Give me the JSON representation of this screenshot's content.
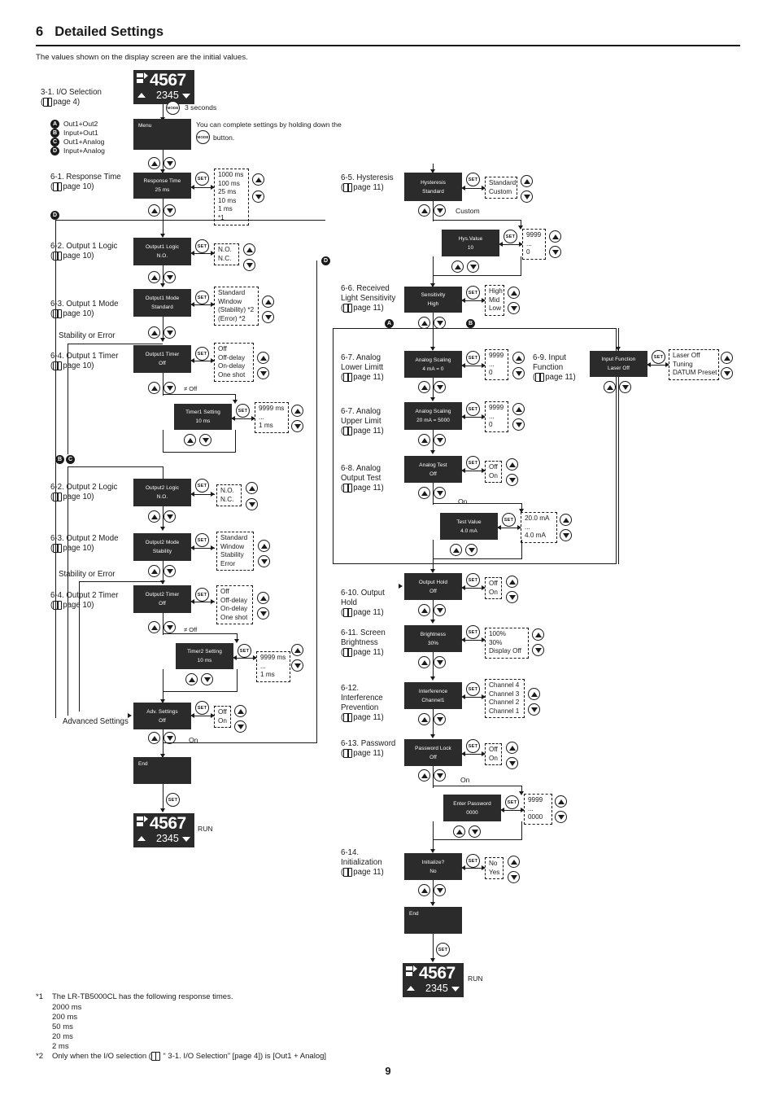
{
  "header": {
    "number": "6",
    "title": "Detailed Settings",
    "intro": "The values shown on the display screen are the initial values."
  },
  "run_display_top": {
    "main": "4567",
    "sub": "2345",
    "label": ""
  },
  "run_display_mid": {
    "main": "4567",
    "sub": "2345",
    "label": "RUN"
  },
  "run_display_bottom": {
    "main": "4567",
    "sub": "2345",
    "label": "RUN"
  },
  "mode_note": {
    "seconds": "3 seconds",
    "button_label": "MODE",
    "text_line1": "You can complete settings by holding down the",
    "text_line2": "button."
  },
  "io_selection": {
    "title": "3-1. I/O Selection",
    "page": "page 4",
    "options": [
      {
        "mark": "A",
        "label": "Out1+Out2"
      },
      {
        "mark": "B",
        "label": "Input+Out1"
      },
      {
        "mark": "C",
        "label": "Out1+Analog"
      },
      {
        "mark": "D",
        "label": "Input+Analog"
      }
    ]
  },
  "menu_screen": {
    "line1": "Menu"
  },
  "set_button_label": "SET",
  "steps": [
    {
      "id": "response-time",
      "title": "6-1. Response Time",
      "page": "page 10",
      "screen": {
        "line1": "Response Time",
        "line2": "25 ms"
      },
      "options": "1000 ms\n100 ms\n25 ms\n10 ms\n1 ms\n*1"
    },
    {
      "id": "output1-logic",
      "title": "6-2. Output 1 Logic",
      "page": "page 10",
      "screen": {
        "line1": "Output1 Logic",
        "line2": "N.O."
      },
      "options": "N.O.\nN.C."
    },
    {
      "id": "output1-mode",
      "title": "6-3. Output 1 Mode",
      "page": "page 10",
      "screen": {
        "line1": "Output1 Mode",
        "line2": "Standard"
      },
      "options": "Standard\nWindow\n(Stability) *2\n(Error) *2"
    },
    {
      "id": "output1-timer",
      "title": "6-4. Output 1 Timer",
      "page": "page 10",
      "screen": {
        "line1": "Output1 Timer",
        "line2": "Off"
      },
      "options": "Off\nOff-delay\nOn-delay\nOne shot"
    },
    {
      "id": "timer1-setting",
      "title": "",
      "page": "",
      "screen": {
        "line1": "Timer1 Setting",
        "line2": "10 ms"
      },
      "options": "9999 ms\n...\n1 ms"
    },
    {
      "id": "output2-logic",
      "title": "6-2. Output 2 Logic",
      "page": "page 10",
      "screen": {
        "line1": "Output2 Logic",
        "line2": "N.O."
      },
      "options": "N.O.\nN.C."
    },
    {
      "id": "output2-mode",
      "title": "6-3. Output 2 Mode",
      "page": "page 10",
      "screen": {
        "line1": "Output2 Mode",
        "line2": "Stability"
      },
      "options": "Standard\nWindow\nStability\nError"
    },
    {
      "id": "output2-timer",
      "title": "6-4. Output 2 Timer",
      "page": "page 10",
      "screen": {
        "line1": "Output2 Timer",
        "line2": "Off"
      },
      "options": "Off\nOff-delay\nOn-delay\nOne shot"
    },
    {
      "id": "timer2-setting",
      "title": "",
      "page": "",
      "screen": {
        "line1": "Timer2 Setting",
        "line2": "10 ms"
      },
      "options": "9999 ms\n...\n1 ms"
    },
    {
      "id": "adv-settings",
      "title": "",
      "page": "",
      "screen": {
        "line1": "Adv. Settings",
        "line2": "Off"
      },
      "options": "Off\nOn"
    },
    {
      "id": "hysteresis",
      "title": "6-5. Hysteresis",
      "page": "page 11",
      "screen": {
        "line1": "Hysteresis",
        "line2": "Standard"
      },
      "options": "Standard\nCustom"
    },
    {
      "id": "hys-value",
      "title": "",
      "page": "",
      "screen": {
        "line1": "Hys.Value",
        "line2": "10"
      },
      "options": "9999\n...\n0"
    },
    {
      "id": "sensitivity",
      "title": "6-6. Received\nLight Sensitivity",
      "page": "page 11",
      "screen": {
        "line1": "Sensitivity",
        "line2": "High"
      },
      "options": "High\nMid\nLow"
    },
    {
      "id": "analog-lower",
      "title": "6-7. Analog\nLower Limitt",
      "page": "page 11",
      "screen": {
        "line1": "Analog Scaling",
        "line2": "4 mA = 0"
      },
      "options": "9999\n...\n0"
    },
    {
      "id": "analog-upper",
      "title": "6-7. Analog\nUpper Limit",
      "page": "page 11",
      "screen": {
        "line1": "Analog Scaling",
        "line2": "20 mA = 5000"
      },
      "options": "9999\n...\n0"
    },
    {
      "id": "analog-test",
      "title": "6-8. Analog\nOutput Test",
      "page": "page 11",
      "screen": {
        "line1": "Analog Test",
        "line2": "Off"
      },
      "options": "Off\nOn"
    },
    {
      "id": "test-value",
      "title": "",
      "page": "",
      "screen": {
        "line1": "Test Value",
        "line2": "4.0 mA"
      },
      "options": "20.0 mA\n...\n4.0 mA"
    },
    {
      "id": "input-function",
      "title": "6-9. Input\nFunction",
      "page": "page 11",
      "screen": {
        "line1": "Input Function",
        "line2": "Laser Off"
      },
      "options": "Laser Off\nTuning\nDATUM Preset"
    },
    {
      "id": "output-hold",
      "title": "6-10. Output\nHold",
      "page": "page 11",
      "screen": {
        "line1": "Output Hold",
        "line2": "Off"
      },
      "options": "Off\nOn"
    },
    {
      "id": "brightness",
      "title": "6-11. Screen\nBrightness",
      "page": "page 11",
      "screen": {
        "line1": "Brightness",
        "line2": "30%"
      },
      "options": "100%\n30%\nDisplay Off"
    },
    {
      "id": "interference",
      "title": "6-12.\nInterference\nPrevention",
      "page": "page 11",
      "screen": {
        "line1": "Interference",
        "line2": "Channel1"
      },
      "options": "Channel 4\nChannel 3\nChannel 2\nChannel 1"
    },
    {
      "id": "password",
      "title": "6-13. Password",
      "page": "page 11",
      "screen": {
        "line1": "Password Lock",
        "line2": "Off"
      },
      "options": "Off\nOn"
    },
    {
      "id": "enter-password",
      "title": "",
      "page": "",
      "screen": {
        "line1": "Enter Password",
        "line2": "0000"
      },
      "options": "9999\n...\n0000"
    },
    {
      "id": "initialization",
      "title": "6-14.\nInitialization",
      "page": "page 11",
      "screen": {
        "line1": "Initialize?",
        "line2": "No"
      },
      "options": "No\nYes"
    }
  ],
  "end_screen_left": {
    "line1": "End"
  },
  "end_screen_right": {
    "line1": "End"
  },
  "labels": {
    "stability_or_error_1": "Stability or Error",
    "stability_or_error_2": "Stability or Error",
    "advanced_settings": "Advanced Settings",
    "custom": "Custom",
    "on_analog_test": "On",
    "on_adv": "On",
    "on_password": "On",
    "not_off_1": "≠ Off",
    "not_off_2": "≠ Off"
  },
  "markers": {
    "d_left": "D",
    "bc_left": "B C",
    "d_right": "D",
    "a_analog": "A",
    "b_analog": "B"
  },
  "footnotes": {
    "n1_mark": "*1",
    "n1_text": "The LR-TB5000CL has the following response times.",
    "n1_values": [
      "2000 ms",
      "200 ms",
      "50 ms",
      "20 ms",
      "2 ms"
    ],
    "n2_mark": "*2",
    "n2_prefix": "Only when the I/O selection (",
    "n2_mid": " “ 3-1. I/O Selection” [page 4]) is [Out1 + Analog]"
  },
  "page_number": "9"
}
